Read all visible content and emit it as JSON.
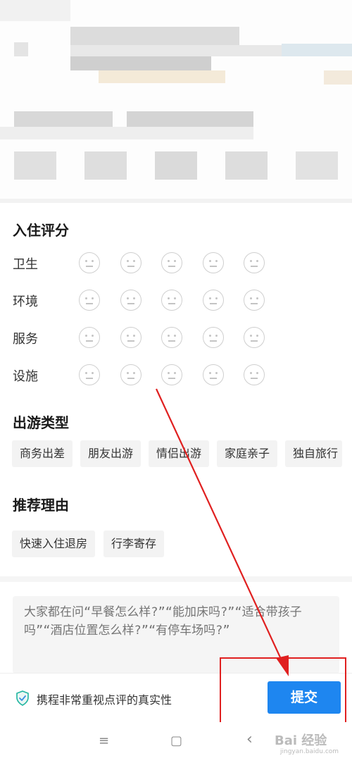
{
  "rating_section": {
    "title": "入住评分",
    "rows": [
      {
        "label": "卫生"
      },
      {
        "label": "环境"
      },
      {
        "label": "服务"
      },
      {
        "label": "设施"
      }
    ]
  },
  "trip_type": {
    "title": "出游类型",
    "tags": [
      "商务出差",
      "朋友出游",
      "情侣出游",
      "家庭亲子",
      "独自旅行"
    ]
  },
  "reasons": {
    "title": "推荐理由",
    "tags": [
      "快速入住退房",
      "行李寄存"
    ]
  },
  "review": {
    "placeholder": "大家都在问“早餐怎么样?”“能加床吗?”“适合带孩子吗”“酒店位置怎么样?”“有停车场吗?”"
  },
  "footer": {
    "assurance": "携程非常重视点评的真实性",
    "submit_label": "提交"
  },
  "nav": {
    "menu_icon": "≡",
    "home_icon": "▢",
    "back_icon": "‹"
  },
  "watermark": {
    "main": "Bai 经验",
    "sub": "jingyan.baidu.com"
  },
  "colors": {
    "accent": "#1e86f0",
    "annotation": "#e02020",
    "shield": "#1fb5a0"
  }
}
